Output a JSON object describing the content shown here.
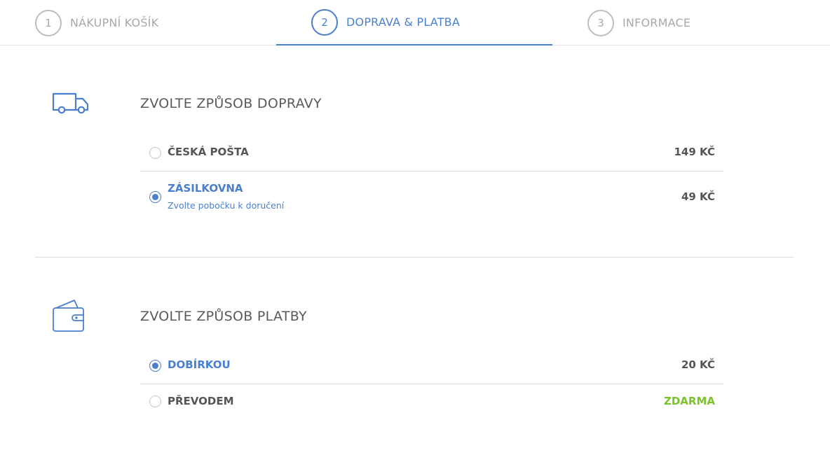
{
  "steps": [
    {
      "number": "1",
      "label": "NÁKUPNÍ KOŠÍK",
      "active": false
    },
    {
      "number": "2",
      "label": "DOPRAVA & PLATBA",
      "active": true
    },
    {
      "number": "3",
      "label": "INFORMACE",
      "active": false
    }
  ],
  "shipping": {
    "icon": "truck-icon",
    "title": "ZVOLTE ZPŮSOB DOPRAVY",
    "options": [
      {
        "name": "ČESKÁ POŠTA",
        "price": "149 KČ",
        "selected": false
      },
      {
        "name": "ZÁSILKOVNA",
        "subtitle": "Zvolte pobočku k doručení",
        "price": "49 KČ",
        "selected": true
      }
    ]
  },
  "payment": {
    "icon": "wallet-icon",
    "title": "ZVOLTE ZPŮSOB PLATBY",
    "options": [
      {
        "name": "DOBÍRKOU",
        "price": "20 KČ",
        "selected": true
      },
      {
        "name": "PŘEVODEM",
        "price": "ZDARMA",
        "selected": false
      }
    ]
  },
  "colors": {
    "accent": "#4a7fd0",
    "free": "#7cc22a",
    "text": "#555555",
    "muted": "#a8a8a8"
  }
}
